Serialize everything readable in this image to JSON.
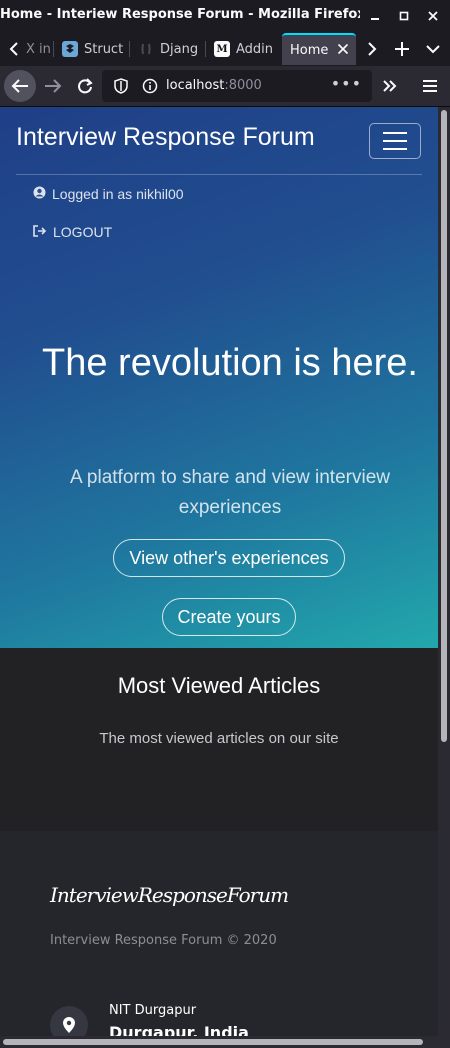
{
  "window": {
    "title": "Home - Interiew Response Forum - Mozilla Firefox"
  },
  "tabs": [
    {
      "label": "X in",
      "favicon": "x-icon"
    },
    {
      "label": "Struct",
      "favicon": "dropbox-icon"
    },
    {
      "label": "Djang",
      "favicon": "django-icon"
    },
    {
      "label": "Addin",
      "favicon": "medium-icon",
      "favicon_text": "M"
    },
    {
      "label": "Home",
      "favicon": "none",
      "active": true
    }
  ],
  "navbar": {
    "url_host": "localhost",
    "url_port": ":8000"
  },
  "site": {
    "brand": "Interview Response Forum",
    "logged_in": "Logged in as nikhil00",
    "logout": "LOGOUT",
    "headline": "The revolution is here.",
    "subtitle": "A platform to share and view interview experiences",
    "btn_view": "View other's experiences",
    "btn_create": "Create yours"
  },
  "most_viewed": {
    "title": "Most Viewed Articles",
    "subtitle": "The most viewed articles on our site"
  },
  "footer": {
    "title": "InterviewResponseForum",
    "copyright": "Interview Response Forum © 2020",
    "location_line1": "NIT Durgapur",
    "location_line2": "Durgapur, India"
  },
  "colors": {
    "hero_start": "#1f3f87",
    "hero_end": "#22a8ac",
    "section_dark": "#222224",
    "footer_bg": "#24262b",
    "tab_accent": "#00ddff"
  }
}
